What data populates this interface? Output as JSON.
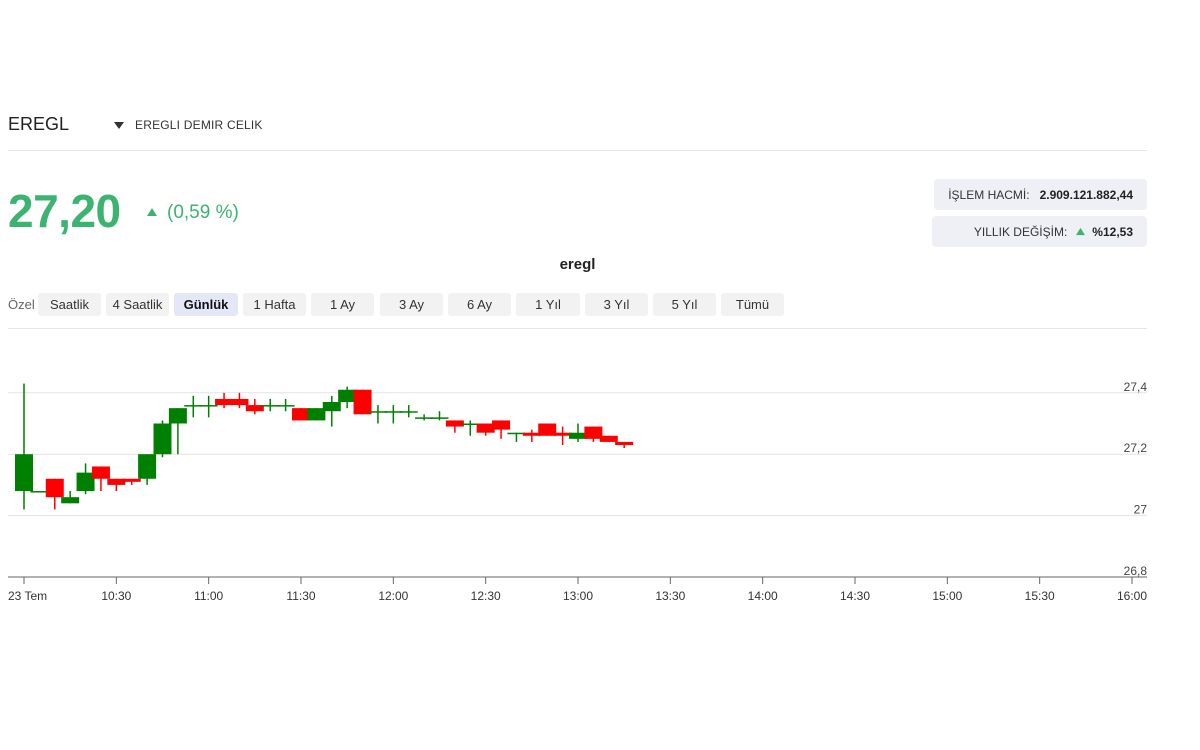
{
  "header": {
    "symbol": "EREGL",
    "company_name": "EREGLI DEMIR CELIK"
  },
  "quote": {
    "price": "27,20",
    "change_pct": "(0,59 %)",
    "trend": "up",
    "color_up": "#3cb371"
  },
  "stats": {
    "volume_label": "İŞLEM HACMİ:",
    "volume_value": "2.909.121.882,44",
    "annual_label": "YILLIK DEĞİŞİM:",
    "annual_value": "%12,53"
  },
  "chart_title": "eregl",
  "ranges": {
    "custom_label": "Özel",
    "buttons": [
      "Saatlik",
      "4 Saatlik",
      "Günlük",
      "1 Hafta",
      "1 Ay",
      "3 Ay",
      "6 Ay",
      "1 Yıl",
      "3 Yıl",
      "5 Yıl",
      "Tümü"
    ],
    "active": "Günlük"
  },
  "chart_data": {
    "type": "candlestick",
    "title": "",
    "x_tick_labels": [
      "23 Tem",
      "10:30",
      "11:00",
      "11:30",
      "12:00",
      "12:30",
      "13:00",
      "13:30",
      "14:00",
      "14:30",
      "15:00",
      "15:30",
      "16:00"
    ],
    "x_ticks": [
      "10:00",
      "10:30",
      "11:00",
      "11:30",
      "12:00",
      "12:30",
      "13:00",
      "13:30",
      "14:00",
      "14:30",
      "15:00",
      "15:30",
      "16:00"
    ],
    "y_tick_labels": [
      "26,8",
      "27",
      "27,2",
      "27,4"
    ],
    "y_ticks": [
      26.8,
      27.0,
      27.2,
      27.4
    ],
    "ylim": [
      26.8,
      27.46
    ],
    "xlim": [
      "10:00",
      "16:00"
    ],
    "interval_minutes": 5,
    "grid": "horizontal",
    "up_color": "#008000",
    "down_color": "#ff0000",
    "candles": [
      {
        "t": "10:00",
        "o": 27.08,
        "h": 27.43,
        "l": 27.02,
        "c": 27.2
      },
      {
        "t": "10:05",
        "o": 27.08,
        "h": 27.08,
        "l": 27.08,
        "c": 27.08
      },
      {
        "t": "10:10",
        "o": 27.12,
        "h": 27.12,
        "l": 27.02,
        "c": 27.06
      },
      {
        "t": "10:15",
        "o": 27.04,
        "h": 27.08,
        "l": 27.04,
        "c": 27.06
      },
      {
        "t": "10:20",
        "o": 27.08,
        "h": 27.17,
        "l": 27.07,
        "c": 27.14
      },
      {
        "t": "10:25",
        "o": 27.16,
        "h": 27.16,
        "l": 27.08,
        "c": 27.12
      },
      {
        "t": "10:30",
        "o": 27.12,
        "h": 27.12,
        "l": 27.08,
        "c": 27.1
      },
      {
        "t": "10:35",
        "o": 27.12,
        "h": 27.12,
        "l": 27.1,
        "c": 27.11
      },
      {
        "t": "10:40",
        "o": 27.12,
        "h": 27.2,
        "l": 27.1,
        "c": 27.2
      },
      {
        "t": "10:45",
        "o": 27.2,
        "h": 27.31,
        "l": 27.19,
        "c": 27.3
      },
      {
        "t": "10:50",
        "o": 27.3,
        "h": 27.35,
        "l": 27.2,
        "c": 27.35
      },
      {
        "t": "10:55",
        "o": 27.36,
        "h": 27.39,
        "l": 27.32,
        "c": 27.36
      },
      {
        "t": "11:00",
        "o": 27.36,
        "h": 27.39,
        "l": 27.32,
        "c": 27.36
      },
      {
        "t": "11:05",
        "o": 27.38,
        "h": 27.4,
        "l": 27.35,
        "c": 27.36
      },
      {
        "t": "11:10",
        "o": 27.38,
        "h": 27.4,
        "l": 27.35,
        "c": 27.36
      },
      {
        "t": "11:15",
        "o": 27.36,
        "h": 27.38,
        "l": 27.33,
        "c": 27.34
      },
      {
        "t": "11:20",
        "o": 27.36,
        "h": 27.38,
        "l": 27.34,
        "c": 27.36
      },
      {
        "t": "11:25",
        "o": 27.36,
        "h": 27.38,
        "l": 27.34,
        "c": 27.36
      },
      {
        "t": "11:30",
        "o": 27.35,
        "h": 27.35,
        "l": 27.31,
        "c": 27.31
      },
      {
        "t": "11:35",
        "o": 27.31,
        "h": 27.35,
        "l": 27.31,
        "c": 27.35
      },
      {
        "t": "11:40",
        "o": 27.34,
        "h": 27.39,
        "l": 27.29,
        "c": 27.37
      },
      {
        "t": "11:45",
        "o": 27.37,
        "h": 27.42,
        "l": 27.35,
        "c": 27.41
      },
      {
        "t": "11:50",
        "o": 27.41,
        "h": 27.41,
        "l": 27.33,
        "c": 27.33
      },
      {
        "t": "11:55",
        "o": 27.34,
        "h": 27.36,
        "l": 27.3,
        "c": 27.34
      },
      {
        "t": "12:00",
        "o": 27.34,
        "h": 27.36,
        "l": 27.3,
        "c": 27.34
      },
      {
        "t": "12:05",
        "o": 27.34,
        "h": 27.36,
        "l": 27.32,
        "c": 27.34
      },
      {
        "t": "12:10",
        "o": 27.32,
        "h": 27.33,
        "l": 27.31,
        "c": 27.32
      },
      {
        "t": "12:15",
        "o": 27.32,
        "h": 27.34,
        "l": 27.31,
        "c": 27.32
      },
      {
        "t": "12:20",
        "o": 27.31,
        "h": 27.31,
        "l": 27.27,
        "c": 27.29
      },
      {
        "t": "12:25",
        "o": 27.3,
        "h": 27.31,
        "l": 27.26,
        "c": 27.3
      },
      {
        "t": "12:30",
        "o": 27.3,
        "h": 27.3,
        "l": 27.26,
        "c": 27.27
      },
      {
        "t": "12:35",
        "o": 27.31,
        "h": 27.31,
        "l": 27.25,
        "c": 27.28
      },
      {
        "t": "12:40",
        "o": 27.27,
        "h": 27.27,
        "l": 27.24,
        "c": 27.27
      },
      {
        "t": "12:45",
        "o": 27.27,
        "h": 27.28,
        "l": 27.24,
        "c": 27.26
      },
      {
        "t": "12:50",
        "o": 27.3,
        "h": 27.3,
        "l": 27.26,
        "c": 27.26
      },
      {
        "t": "12:55",
        "o": 27.27,
        "h": 27.29,
        "l": 27.23,
        "c": 27.26
      },
      {
        "t": "13:00",
        "o": 27.25,
        "h": 27.3,
        "l": 27.24,
        "c": 27.27
      },
      {
        "t": "13:05",
        "o": 27.29,
        "h": 27.29,
        "l": 27.24,
        "c": 27.25
      },
      {
        "t": "13:10",
        "o": 27.26,
        "h": 27.26,
        "l": 27.24,
        "c": 27.24
      },
      {
        "t": "13:15",
        "o": 27.24,
        "h": 27.24,
        "l": 27.22,
        "c": 27.23
      }
    ]
  }
}
